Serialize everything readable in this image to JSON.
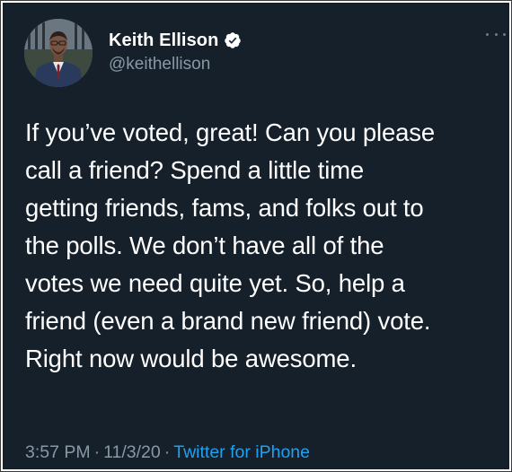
{
  "tweet": {
    "author": {
      "display_name": "Keith Ellison",
      "handle": "@keithellison",
      "verified": true
    },
    "text_lines": [
      "If you’ve voted, great! Can you please",
      "call a friend? Spend a little time",
      "getting friends, fams, and folks out to",
      "the polls.  We don’t have all of the",
      "votes we need quite yet.  So, help a",
      "friend (even a brand new friend) vote.",
      "Right now would be awesome."
    ],
    "meta": {
      "time": "3:57 PM",
      "date": "11/3/20",
      "separator": "·",
      "source": "Twitter for iPhone"
    }
  },
  "colors": {
    "background": "#15202b",
    "text": "#ffffff",
    "secondary_text": "#8899a6",
    "link": "#1da1f2",
    "verified_badge": "#ffffff"
  },
  "icons": {
    "verified": "verified-badge-icon",
    "more": "more-options-icon"
  }
}
